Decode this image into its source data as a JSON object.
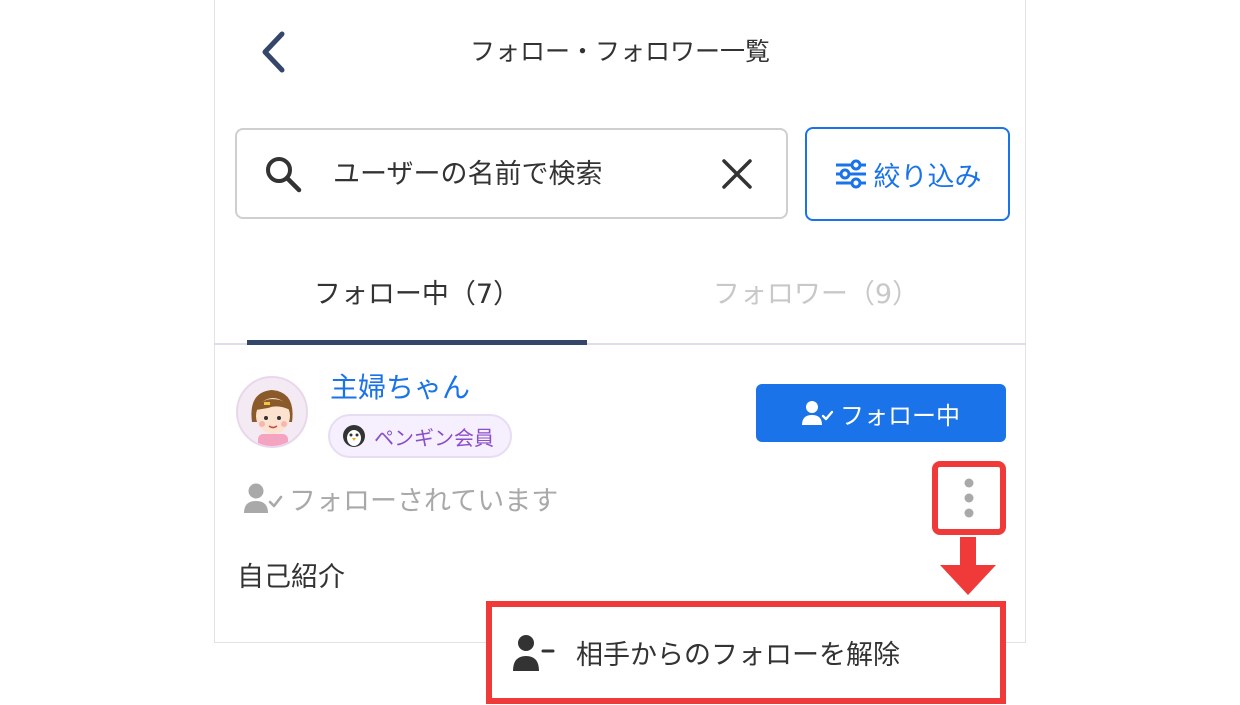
{
  "header": {
    "title": "フォロー・フォロワー一覧"
  },
  "search": {
    "placeholder": "ユーザーの名前で検索"
  },
  "filter": {
    "label": "絞り込み"
  },
  "tabs": [
    {
      "label": "フォロー中（7）",
      "active": true
    },
    {
      "label": "フォロワー（9）",
      "active": false
    }
  ],
  "user": {
    "name": "主婦ちゃん",
    "badge": "ペンギン会員",
    "follow_button": "フォロー中",
    "followed_status": "フォローされています",
    "bio_label": "自己紹介"
  },
  "menu": {
    "remove_follower": "相手からのフォローを解除"
  },
  "colors": {
    "accent": "#1a73e8",
    "highlight": "#f03a3a",
    "badge_text": "#8a4fc9",
    "tab_indicator": "#34466a"
  },
  "icons": [
    "back-chevron-icon",
    "search-icon",
    "clear-icon",
    "filter-sliders-icon",
    "penguin-icon",
    "user-check-icon",
    "more-vertical-icon",
    "down-arrow-icon",
    "user-minus-icon"
  ]
}
